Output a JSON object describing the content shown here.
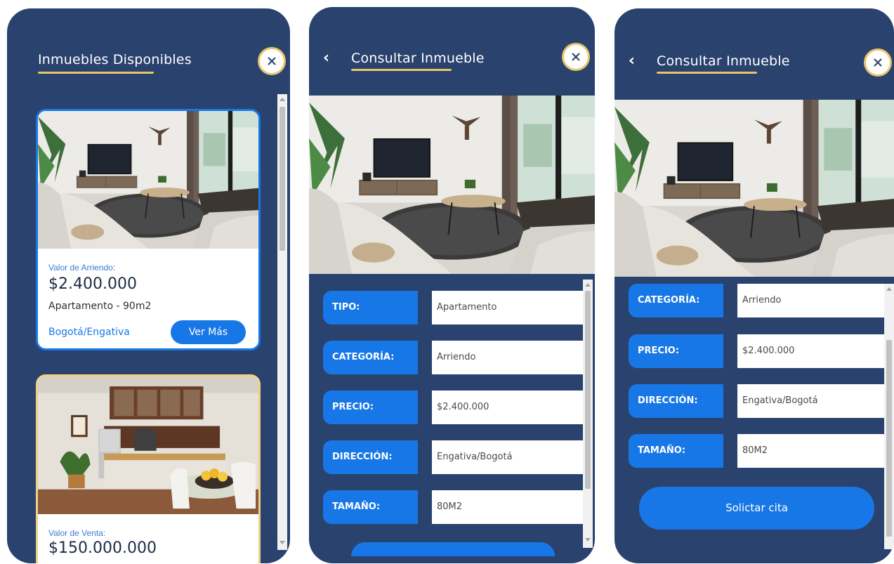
{
  "colors": {
    "panel": "#2a426e",
    "accent": "#1877e6",
    "underline": "#e9c46a",
    "card_border_featured": "#1877e6",
    "card_border_secondary": "#f0d084"
  },
  "screen1": {
    "title": "Inmuebles Disponibles",
    "close_icon": "close-icon",
    "listings": [
      {
        "image": "living-room-photo",
        "price_label": "Valor de Arriendo:",
        "price": "$2.400.000",
        "type_size": "Apartamento - 90m2",
        "location": "Bogotá/Engativa",
        "cta": "Ver Más"
      },
      {
        "image": "kitchen-photo",
        "price_label": "Valor de Venta:",
        "price": "$150.000.000"
      }
    ]
  },
  "screen2": {
    "title": "Consultar Inmueble",
    "back_icon": "back-chevron-icon",
    "close_icon": "close-icon",
    "image": "living-room-photo",
    "fields": [
      {
        "label": "TIPO:",
        "value": "Apartamento"
      },
      {
        "label": "CATEGORÍA:",
        "value": "Arriendo"
      },
      {
        "label": "PRECIO:",
        "value": "$2.400.000"
      },
      {
        "label": "DIRECCIÓN:",
        "value": "Engativa/Bogotá"
      },
      {
        "label": "TAMAÑO:",
        "value": "80M2"
      }
    ]
  },
  "screen3": {
    "title": "Consultar Inmueble",
    "back_icon": "back-chevron-icon",
    "close_icon": "close-icon",
    "image": "living-room-photo",
    "fields": [
      {
        "label": "CATEGORÍA:",
        "value": "Arriendo"
      },
      {
        "label": "PRECIO:",
        "value": "$2.400.000"
      },
      {
        "label": "DIRECCIÓN:",
        "value": "Engativa/Bogotá"
      },
      {
        "label": "TAMAÑO:",
        "value": "80M2"
      }
    ],
    "cta": "Solictar cita"
  }
}
